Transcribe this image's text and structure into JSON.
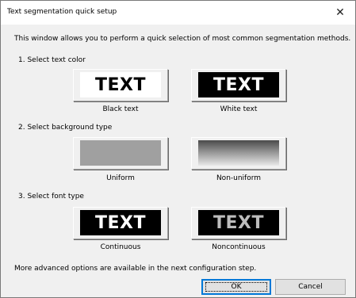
{
  "window": {
    "title": "Text segmentation quick setup",
    "close_glyph": "✕"
  },
  "intro": "This window allows you to perform a quick selection of most common segmentation methods.",
  "sections": {
    "text_color": {
      "heading": "1. Select text color",
      "options": [
        {
          "sample_text": "TEXT",
          "caption": "Black text",
          "sample_bg": "#ffffff",
          "sample_fg": "#000000"
        },
        {
          "sample_text": "TEXT",
          "caption": "White text",
          "sample_bg": "#000000",
          "sample_fg": "#ffffff"
        }
      ]
    },
    "background_type": {
      "heading": "2. Select background type",
      "options": [
        {
          "caption": "Uniform",
          "sample_bg": "#a0a0a0"
        },
        {
          "caption": "Non-uniform",
          "sample_gradient": [
            "#4a4a4a",
            "#e8e8e8"
          ]
        }
      ]
    },
    "font_type": {
      "heading": "3. Select font type",
      "options": [
        {
          "sample_text": "TEXT",
          "caption": "Continuous",
          "sample_bg": "#000000",
          "sample_fg": "#ffffff"
        },
        {
          "sample_text": "TEXT",
          "caption": "Noncontinuous",
          "sample_bg": "#000000",
          "sample_fg": "#bdbdbd"
        }
      ]
    }
  },
  "footer_note": "More advanced options are available in the next configuration step.",
  "buttons": {
    "ok": "OK",
    "cancel": "Cancel"
  }
}
